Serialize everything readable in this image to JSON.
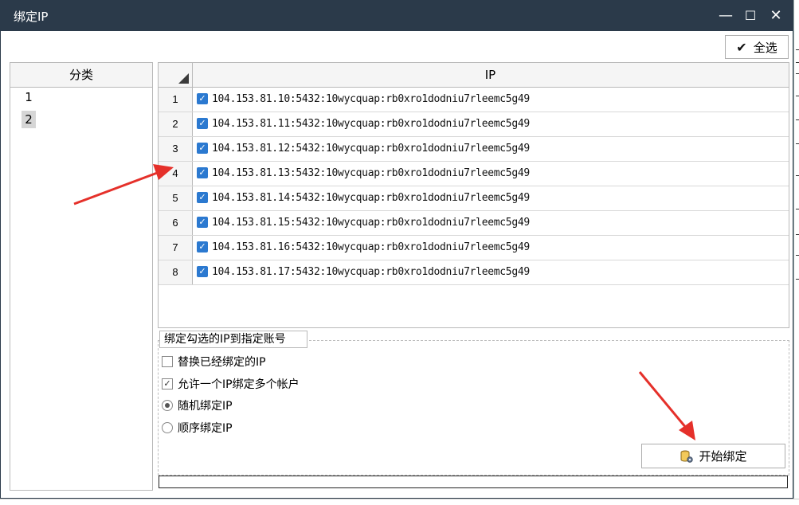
{
  "window": {
    "title": "绑定IP",
    "minimize": "—",
    "maximize": "☐",
    "close": "✕"
  },
  "toolbar": {
    "select_all_label": "全选"
  },
  "category": {
    "header": "分类",
    "items": [
      "1",
      "2"
    ],
    "selected": "2"
  },
  "grid": {
    "column_header": "IP",
    "rows": [
      {
        "num": "1",
        "ip": "104.153.81.10:5432:10wycquap:rb0xro1dodniu7rleemc5g49",
        "checked": true
      },
      {
        "num": "2",
        "ip": "104.153.81.11:5432:10wycquap:rb0xro1dodniu7rleemc5g49",
        "checked": true
      },
      {
        "num": "3",
        "ip": "104.153.81.12:5432:10wycquap:rb0xro1dodniu7rleemc5g49",
        "checked": true
      },
      {
        "num": "4",
        "ip": "104.153.81.13:5432:10wycquap:rb0xro1dodniu7rleemc5g49",
        "checked": true
      },
      {
        "num": "5",
        "ip": "104.153.81.14:5432:10wycquap:rb0xro1dodniu7rleemc5g49",
        "checked": true
      },
      {
        "num": "6",
        "ip": "104.153.81.15:5432:10wycquap:rb0xro1dodniu7rleemc5g49",
        "checked": true
      },
      {
        "num": "7",
        "ip": "104.153.81.16:5432:10wycquap:rb0xro1dodniu7rleemc5g49",
        "checked": true
      },
      {
        "num": "8",
        "ip": "104.153.81.17:5432:10wycquap:rb0xro1dodniu7rleemc5g49",
        "checked": true
      }
    ]
  },
  "options": {
    "group_title": "绑定勾选的IP到指定账号",
    "replace_bound": {
      "label": "替换已经绑定的IP",
      "checked": false
    },
    "allow_multi": {
      "label": "允许一个IP绑定多个帐户",
      "checked": true
    },
    "random_bind": {
      "label": "随机绑定IP",
      "selected": true
    },
    "sequential_bind": {
      "label": "顺序绑定IP",
      "selected": false
    }
  },
  "start_button": {
    "label": "开始绑定"
  },
  "progress": {
    "value": 0
  },
  "colors": {
    "titlebar": "#2b3a4a",
    "checkbox": "#2b79d0",
    "arrow": "#e5302a"
  }
}
